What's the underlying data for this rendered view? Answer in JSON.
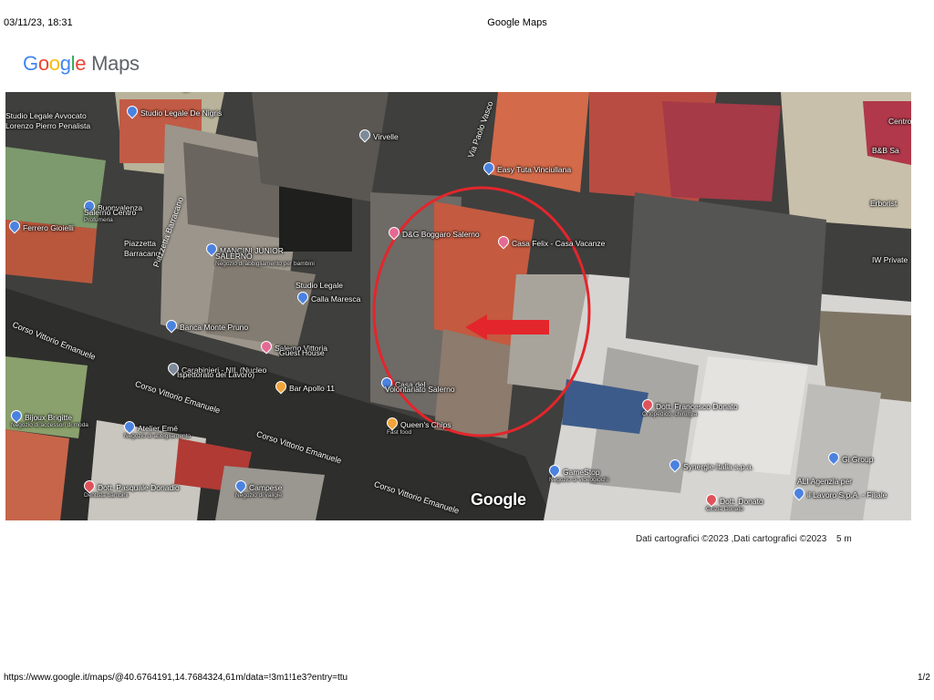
{
  "header": {
    "datetime": "03/11/23, 18:31",
    "title": "Google Maps"
  },
  "logo": {
    "google": "Google",
    "maps": "Maps"
  },
  "map": {
    "watermark": "Google",
    "places": [
      {
        "name": "Studio Legale De Nigris",
        "sub": "",
        "icon": "blue"
      },
      {
        "name": "Studio Legale Avvocato",
        "sub": "",
        "icon": ""
      },
      {
        "name": "Lorenzo Pierro Penalista",
        "sub": "",
        "icon": ""
      },
      {
        "name": "Virvelle",
        "sub": "",
        "icon": "gray"
      },
      {
        "name": "Ferrero Gioielli",
        "sub": "",
        "icon": "blue"
      },
      {
        "name": "Buonvalenza",
        "sub": "",
        "icon": "blue"
      },
      {
        "name": "Salerno Centro",
        "sub": "Profumeria",
        "icon": ""
      },
      {
        "name": "MANCINI JUNIOR",
        "sub": "",
        "icon": "blue"
      },
      {
        "name": "SALERNO",
        "sub": "Negozio di abbigliamento per bambini",
        "icon": ""
      },
      {
        "name": "Piazzetta",
        "sub": "",
        "icon": ""
      },
      {
        "name": "Barracano",
        "sub": "",
        "icon": ""
      },
      {
        "name": "Studio Legale",
        "sub": "",
        "icon": ""
      },
      {
        "name": "Calla Maresca",
        "sub": "",
        "icon": "blue"
      },
      {
        "name": "Banca Monte Pruno",
        "sub": "",
        "icon": "blue"
      },
      {
        "name": "Salerno Vittoria",
        "sub": "",
        "icon": "pink"
      },
      {
        "name": "Guest House",
        "sub": "",
        "icon": ""
      },
      {
        "name": "Carabinieri - NIL (Nucleo",
        "sub": "",
        "icon": "gray"
      },
      {
        "name": "Ispettorato del Lavoro)",
        "sub": "",
        "icon": ""
      },
      {
        "name": "Bar Apollo 11",
        "sub": "",
        "icon": "orange"
      },
      {
        "name": "Casa del",
        "sub": "",
        "icon": "blue"
      },
      {
        "name": "Volontariato Salerno",
        "sub": "",
        "icon": ""
      },
      {
        "name": "D&G Boggaro Salerno",
        "sub": "",
        "icon": "pink"
      },
      {
        "name": "Casa Felix - Casa Vacanze",
        "sub": "",
        "icon": "pink"
      },
      {
        "name": "Easy Tuta Vinciullana",
        "sub": "",
        "icon": "blue"
      },
      {
        "name": "Queen's Chips",
        "sub": "Fast food",
        "icon": "orange"
      },
      {
        "name": "Bijoux Brigitte",
        "sub": "Negozio di accessori di moda",
        "icon": "blue"
      },
      {
        "name": "Atelier Emé",
        "sub": "Negozio di abbigliamento",
        "icon": "blue"
      },
      {
        "name": "Dott. Pasquale Donadio",
        "sub": "Dentista bambini",
        "icon": "red"
      },
      {
        "name": "Campese",
        "sub": "Negozio di valigie",
        "icon": "blue"
      },
      {
        "name": "Dott. Francesco Donato",
        "sub": "Ortopedico, chirurgia",
        "icon": "red"
      },
      {
        "name": "GameStop",
        "sub": "Negozio di videogiochi",
        "icon": "blue"
      },
      {
        "name": "Synergie Italia s.p.a.",
        "sub": "",
        "icon": "blue"
      },
      {
        "name": "Dott. Donato",
        "sub": "Cinzia Donato",
        "icon": "red"
      },
      {
        "name": "Gi Group",
        "sub": "",
        "icon": "blue"
      },
      {
        "name": "ALI Agenzia per",
        "sub": "",
        "icon": ""
      },
      {
        "name": "il Lavoro S.p.A. - Filiale",
        "sub": "",
        "icon": "blue"
      },
      {
        "name": "B&B Sa",
        "sub": "",
        "icon": ""
      },
      {
        "name": "Centro",
        "sub": "",
        "icon": ""
      },
      {
        "name": "Erborist",
        "sub": "",
        "icon": ""
      },
      {
        "name": "IW Private",
        "sub": "",
        "icon": ""
      }
    ],
    "streets": [
      {
        "name": "Piazza"
      },
      {
        "name": "Piazzetta Barracano"
      },
      {
        "name": "Corso Vittorio Emanuele"
      },
      {
        "name": "Corso Vittorio Emanuele"
      },
      {
        "name": "Corso Vittorio Emanuele"
      },
      {
        "name": "Corso Vittorio Emanuele"
      },
      {
        "name": "Via Paolo Vasco"
      }
    ]
  },
  "footer": {
    "copyright": "Dati cartografici ©2023 ,Dati cartografici ©2023",
    "scale": "5 m",
    "url": "https://www.google.it/maps/@40.6764191,14.7684324,61m/data=!3m1!1e3?entry=ttu",
    "page": "1/2"
  },
  "annotation": {
    "circle_color": "#e3262b",
    "arrow_color": "#e3262b"
  }
}
